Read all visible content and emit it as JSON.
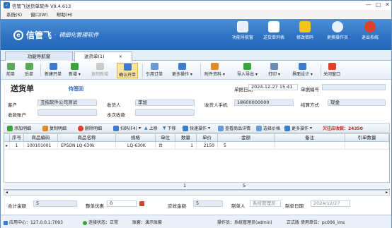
{
  "window": {
    "title": "信管飞送货单软件 V9.4.613",
    "minimize": "—",
    "maximize": "□",
    "close": "✕"
  },
  "menu": [
    "系统(S)",
    "窗口(W)",
    "帮助(H)"
  ],
  "brand": {
    "mark": "e",
    "name": "信管飞",
    "dot": "·",
    "slogan": "精细化管理软件"
  },
  "top_buttons": [
    {
      "label": "功能导航窗",
      "icon": "monitor-icon",
      "color": "#e8f0fb"
    },
    {
      "label": "送货单列表",
      "icon": "list-icon",
      "color": "#ffffff"
    },
    {
      "label": "修改密码",
      "icon": "lock-icon",
      "color": "#f5c518"
    },
    {
      "label": "更换操作员",
      "icon": "user-switch-icon",
      "color": "#e8f0fb"
    },
    {
      "label": "退出系统",
      "icon": "exit-icon",
      "color": "#e0402a"
    }
  ],
  "tabs": {
    "nav": "功能导航窗",
    "doc": "送货单(1)",
    "close": "×"
  },
  "toolbar": {
    "first": "前单",
    "next": "后单",
    "new": "新建开单",
    "new_dd": "新增",
    "copy": "复制新增",
    "confirm": "确认开单",
    "ref": "引用订单",
    "more": "更多操作",
    "attach": "附件资料",
    "import": "导入导出",
    "print": "打印",
    "ui": "界面设计",
    "close": "关闭窗口"
  },
  "doc": {
    "title": "送货单",
    "status": "待签回",
    "date_label": "单据日期",
    "date": "2024-12-27  15:41",
    "no_label": "单据编号",
    "no": ""
  },
  "form": {
    "customer_label": "客户",
    "customer": "丑指软件公司测试",
    "receiver_label": "收货人",
    "receiver": "李加",
    "phone_label": "收货人手机",
    "phone": "18600000000",
    "settle_label": "结算方式",
    "settle": "现金",
    "account_label": "收款账户",
    "account": "",
    "collect_label": "本次收款",
    "collect": ""
  },
  "grid_toolbar": {
    "add": "添加明细",
    "copy": "复制明细",
    "del": "删除明细",
    "scan": "扫码(F4)",
    "up": "上移",
    "down": "下移",
    "quick": "快速操作",
    "detail": "查看商品详情",
    "price": "选择价格",
    "more": "更多操作",
    "owed": "欠往应收款：24350"
  },
  "grid": {
    "headers": [
      "序号",
      "商品编码",
      "商品名称",
      "规格",
      "单位",
      "数量",
      "单价",
      "金额",
      "备注",
      "引单数量"
    ],
    "rows": [
      {
        "no": "1",
        "code": "100101001",
        "name": "EPSON LQ-630k",
        "spec": "LQ-630K",
        "unit": "台",
        "qty": "1",
        "price": "2150",
        "amount": "5",
        "note": "",
        "ref": ""
      }
    ],
    "sum_qty": "1",
    "sum_amount": "5"
  },
  "footer": {
    "total_label": "合计金额",
    "total": "5",
    "discount_label": "整单优惠",
    "discount": "0",
    "receivable_label": "应收金额",
    "receivable": "5",
    "maker_label": "制单人",
    "maker": "系统管理员",
    "make_date_label": "制单日期",
    "make_date": "2024/12/27"
  },
  "status": {
    "center": "应用中心：127.0.0.1:7093",
    "conn": "连接状态：正常",
    "account": "账套：演示账套",
    "operator": "操作员：系统管理员(admin)",
    "edition": "正式版 使用单位：pc006_ims"
  }
}
